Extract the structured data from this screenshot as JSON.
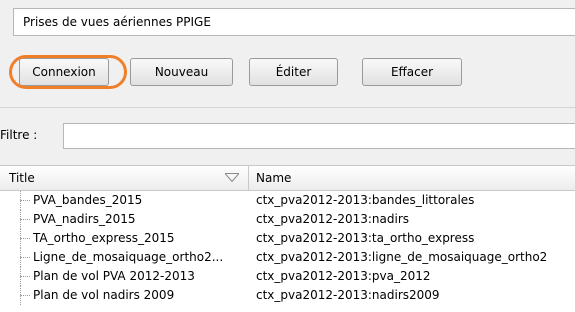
{
  "layer_select": {
    "value": "Prises de vues aériennes PPIGE"
  },
  "toolbar": {
    "connexion": "Connexion",
    "nouveau": "Nouveau",
    "editer": "Éditer",
    "effacer": "Effacer"
  },
  "filter": {
    "label": "Filtre :",
    "value": ""
  },
  "table": {
    "columns": [
      "Title",
      "Name"
    ],
    "rows": [
      {
        "title": "PVA_bandes_2015",
        "name": "ctx_pva2012-2013:bandes_littorales"
      },
      {
        "title": "PVA_nadirs_2015",
        "name": "ctx_pva2012-2013:nadirs"
      },
      {
        "title": "TA_ortho_express_2015",
        "name": "ctx_pva2012-2013:ta_ortho_express"
      },
      {
        "title": "Ligne_de_mosaiquage_ortho2...",
        "name": "ctx_pva2012-2013:ligne_de_mosaiquage_ortho2"
      },
      {
        "title": "Plan de vol PVA 2012-2013",
        "name": "ctx_pva2012-2013:pva_2012"
      },
      {
        "title": "Plan de vol nadirs 2009",
        "name": "ctx_pva2012-2013:nadirs2009"
      }
    ]
  },
  "colors": {
    "highlight": "#f07f2a"
  },
  "icons": {
    "sort": "sort-indicator-icon"
  }
}
